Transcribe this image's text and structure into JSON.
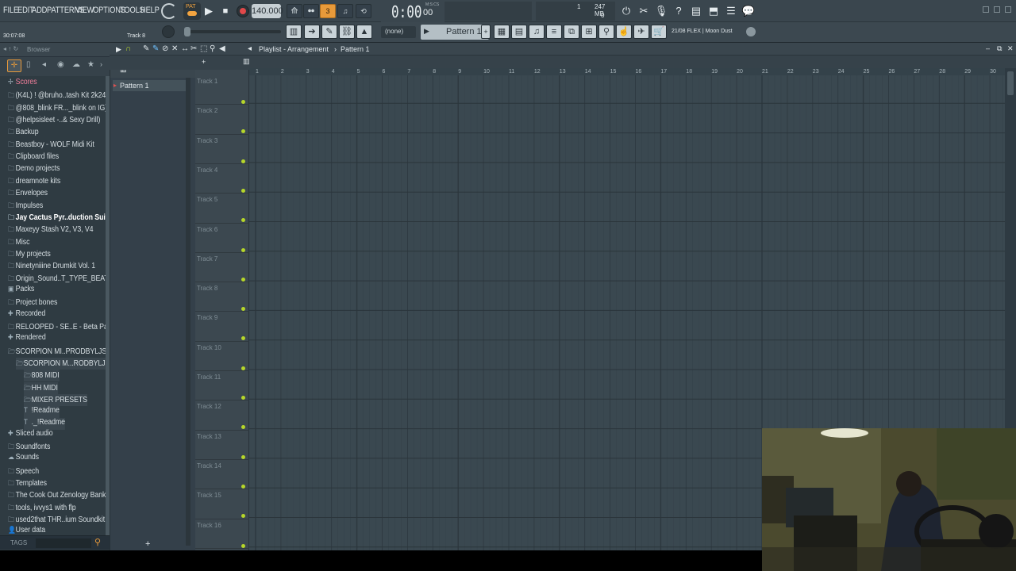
{
  "menu": [
    "FILE",
    "EDIT",
    "ADD",
    "PATTERNS",
    "VIEW",
    "OPTIONS",
    "TOOLS",
    "HELP"
  ],
  "transport": {
    "pat_song": "PAT",
    "tempo": "140.000",
    "time": "0:00",
    "time_small": "00",
    "time_unit": "M:S:CS",
    "memory": "247 MB",
    "cpu_top": "1",
    "cpu_bottom": "0"
  },
  "hint": {
    "time": "30:07:08",
    "track": "Track 8"
  },
  "pattern_selector": {
    "none_label": "(none)",
    "pattern_label": "Pattern 1",
    "news": "21/08  FLEX | Moon Dust"
  },
  "browser": {
    "title": "Browser",
    "items": [
      {
        "label": "Scores",
        "icon": "cross",
        "style": "pink"
      },
      {
        "label": "(K4L) ! @bruho..tash Kit 2k24",
        "icon": "folder",
        "style": ""
      },
      {
        "label": "@808_blink FR..._blink on IG)",
        "icon": "folder",
        "style": ""
      },
      {
        "label": "@helpsisleet -..& Sexy Drill)",
        "icon": "folder",
        "style": ""
      },
      {
        "label": "Backup",
        "icon": "folder",
        "style": ""
      },
      {
        "label": "Beastboy - WOLF Midi Kit",
        "icon": "folder",
        "style": ""
      },
      {
        "label": "Clipboard files",
        "icon": "folder",
        "style": ""
      },
      {
        "label": "Demo projects",
        "icon": "folder",
        "style": ""
      },
      {
        "label": "dreamnote kits",
        "icon": "folder",
        "style": ""
      },
      {
        "label": "Envelopes",
        "icon": "folder",
        "style": ""
      },
      {
        "label": "Impulses",
        "icon": "folder",
        "style": ""
      },
      {
        "label": "Jay Cactus Pyr..duction Suite",
        "icon": "folder",
        "style": "bold"
      },
      {
        "label": "Maxeyy Stash V2, V3, V4",
        "icon": "folder",
        "style": ""
      },
      {
        "label": "Misc",
        "icon": "folder",
        "style": ""
      },
      {
        "label": "My projects",
        "icon": "folder",
        "style": ""
      },
      {
        "label": "Ninetyniiine Drumkit Vol. 1",
        "icon": "folder",
        "style": ""
      },
      {
        "label": "Origin_Sound..T_TYPE_BEATS",
        "icon": "folder",
        "style": ""
      },
      {
        "label": "Packs",
        "icon": "packs",
        "style": ""
      },
      {
        "label": "Project bones",
        "icon": "folder",
        "style": ""
      },
      {
        "label": "Recorded",
        "icon": "plus",
        "style": ""
      },
      {
        "label": "RELOOPED - SE..E - Beta Pack",
        "icon": "folder",
        "style": ""
      },
      {
        "label": "Rendered",
        "icon": "plus",
        "style": ""
      },
      {
        "label": "SCORPION MI..PRODBYLJS",
        "icon": "folder-open",
        "style": ""
      }
    ],
    "subitems": [
      {
        "label": "SCORPION M...RODBYLJS",
        "indent": 1
      },
      {
        "label": "808 MIDI",
        "indent": 2
      },
      {
        "label": "HH MIDI",
        "indent": 2
      },
      {
        "label": "MIXER PRESETS",
        "indent": 2
      },
      {
        "label": "!Readme",
        "indent": 2,
        "file": true
      },
      {
        "label": "._!Readme",
        "indent": 2,
        "file": true
      }
    ],
    "items2": [
      {
        "label": "Sliced audio",
        "icon": "plus"
      },
      {
        "label": "Soundfonts",
        "icon": "folder"
      },
      {
        "label": "Sounds",
        "icon": "cloud"
      },
      {
        "label": "Speech",
        "icon": "folder"
      },
      {
        "label": "Templates",
        "icon": "folder"
      },
      {
        "label": "The Cook Out Zenology Bank",
        "icon": "folder"
      },
      {
        "label": "tools, ivvys1 with flp",
        "icon": "folder"
      },
      {
        "label": "used2that THR..ium Soundkit",
        "icon": "folder"
      },
      {
        "label": "User data",
        "icon": "user"
      }
    ],
    "tags_label": "TAGS"
  },
  "pattern_list": [
    "Pattern 1"
  ],
  "playlist": {
    "title": "Playlist - Arrangement",
    "pattern": "Pattern 1",
    "tracks": [
      "Track 1",
      "Track 2",
      "Track 3",
      "Track 4",
      "Track 5",
      "Track 6",
      "Track 7",
      "Track 8",
      "Track 9",
      "Track 10",
      "Track 11",
      "Track 12",
      "Track 13",
      "Track 14",
      "Track 15",
      "Track 16"
    ],
    "bars": [
      "1",
      "2",
      "3",
      "4",
      "5",
      "6",
      "7",
      "8",
      "9",
      "10",
      "11",
      "12",
      "13",
      "14",
      "15",
      "16",
      "17",
      "18",
      "19",
      "20",
      "21",
      "22",
      "23",
      "24",
      "25",
      "26",
      "27",
      "28",
      "29",
      "30"
    ]
  }
}
